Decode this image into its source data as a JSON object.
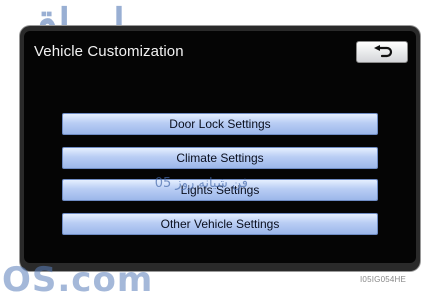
{
  "watermark": {
    "top_text": "اوراق",
    "bottom_text": "OS.com",
    "overlay_text": "فن شیانه روز 05"
  },
  "screen": {
    "title": "Vehicle Customization",
    "back_icon": "return-arrow-icon",
    "buttons": [
      {
        "label": "Door Lock Settings"
      },
      {
        "label": "Climate Settings"
      },
      {
        "label": "Lights Settings"
      },
      {
        "label": "Other Vehicle Settings"
      }
    ]
  },
  "figure_code": "I05IG054HE"
}
